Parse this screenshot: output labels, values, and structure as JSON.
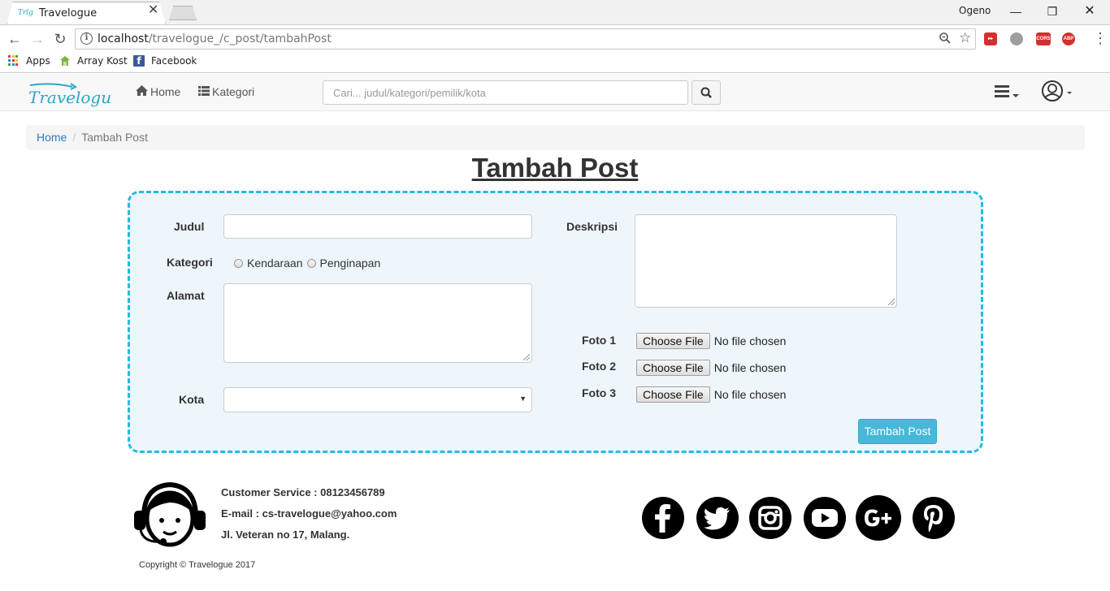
{
  "browser": {
    "tab_title": "Travelogue",
    "tab_favicon_text": "Trlg",
    "profile_name": "Ogeno",
    "url_host": "localhost",
    "url_path": "/travelogue_/c_post/tambahPost",
    "bookmarks": [
      {
        "label": "Apps",
        "icon": "apps-grid-icon"
      },
      {
        "label": "Array Kost",
        "icon": "array-kost-icon"
      },
      {
        "label": "Facebook",
        "icon": "facebook-icon"
      }
    ],
    "extensions": [
      {
        "icon": "pocket-ext-icon",
        "color": "#d32f2f",
        "text": ""
      },
      {
        "icon": "gray-ext-icon",
        "color": "#9e9e9e",
        "text": ""
      },
      {
        "icon": "cors-ext-icon",
        "color": "#d32f2f",
        "text": "CORS"
      },
      {
        "icon": "adblock-plus-ext-icon",
        "color": "#d32f2f",
        "text": "ABP"
      }
    ]
  },
  "navbar": {
    "brand": "Travelogue",
    "home_label": "Home",
    "kategori_label": "Kategori",
    "search_placeholder": "Cari... judul/kategori/pemilik/kota"
  },
  "breadcrumb": {
    "home": "Home",
    "separator": "/",
    "current": "Tambah Post"
  },
  "page_title": "Tambah Post",
  "form": {
    "judul_label": "Judul",
    "judul_value": "",
    "kategori_label": "Kategori",
    "kategori_options": [
      "Kendaraan",
      "Penginapan"
    ],
    "alamat_label": "Alamat",
    "alamat_value": "",
    "kota_label": "Kota",
    "kota_value": "",
    "deskripsi_label": "Deskripsi",
    "deskripsi_value": "",
    "photos": [
      {
        "label": "Foto 1",
        "button": "Choose File",
        "status": "No file chosen"
      },
      {
        "label": "Foto 2",
        "button": "Choose File",
        "status": "No file chosen"
      },
      {
        "label": "Foto 3",
        "button": "Choose File",
        "status": "No file chosen"
      }
    ],
    "submit_label": "Tambah Post"
  },
  "footer": {
    "customer_service": "Customer Service : 08123456789",
    "email": "E-mail : cs-travelogue@yahoo.com",
    "address": "Jl. Veteran no 17, Malang.",
    "copyright": "Copyright © Travelogue 2017",
    "social": [
      "facebook-icon",
      "twitter-icon",
      "instagram-icon",
      "youtube-icon",
      "google-plus-icon",
      "pinterest-icon"
    ]
  },
  "colors": {
    "accent": "#1fbde6",
    "button": "#46b8da",
    "panel_bg": "#eef6fb",
    "link": "#337ab7",
    "logo": "#2aa8c4"
  }
}
